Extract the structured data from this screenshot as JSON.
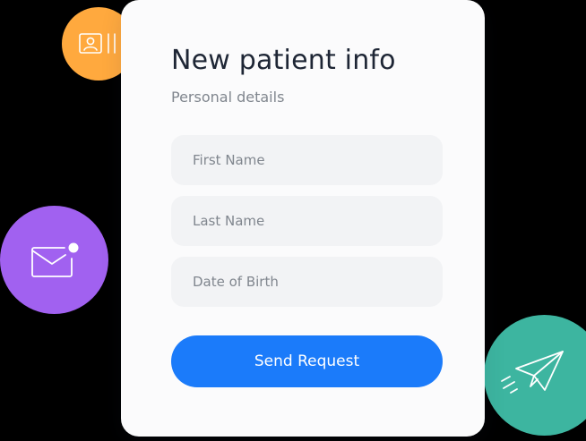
{
  "form": {
    "title": "New patient info",
    "subtitle": "Personal details",
    "fields": {
      "first_name": {
        "value": "",
        "placeholder": "First Name"
      },
      "last_name": {
        "value": "",
        "placeholder": "Last Name"
      },
      "date_of_birth": {
        "value": "",
        "placeholder": "Date of Birth"
      }
    },
    "submit_label": "Send Request"
  },
  "decorations": {
    "id_card": {
      "icon": "id-card-icon",
      "color": "#FFA93E"
    },
    "mail": {
      "icon": "mail-notification-icon",
      "color": "#A161F0"
    },
    "send": {
      "icon": "paper-plane-icon",
      "color": "#3DB5A0"
    }
  },
  "colors": {
    "accent": "#1B7BFA",
    "card_background": "#FBFBFC",
    "field_background": "#F2F3F5",
    "title_text": "#1E2635",
    "muted_text": "#80868E"
  }
}
